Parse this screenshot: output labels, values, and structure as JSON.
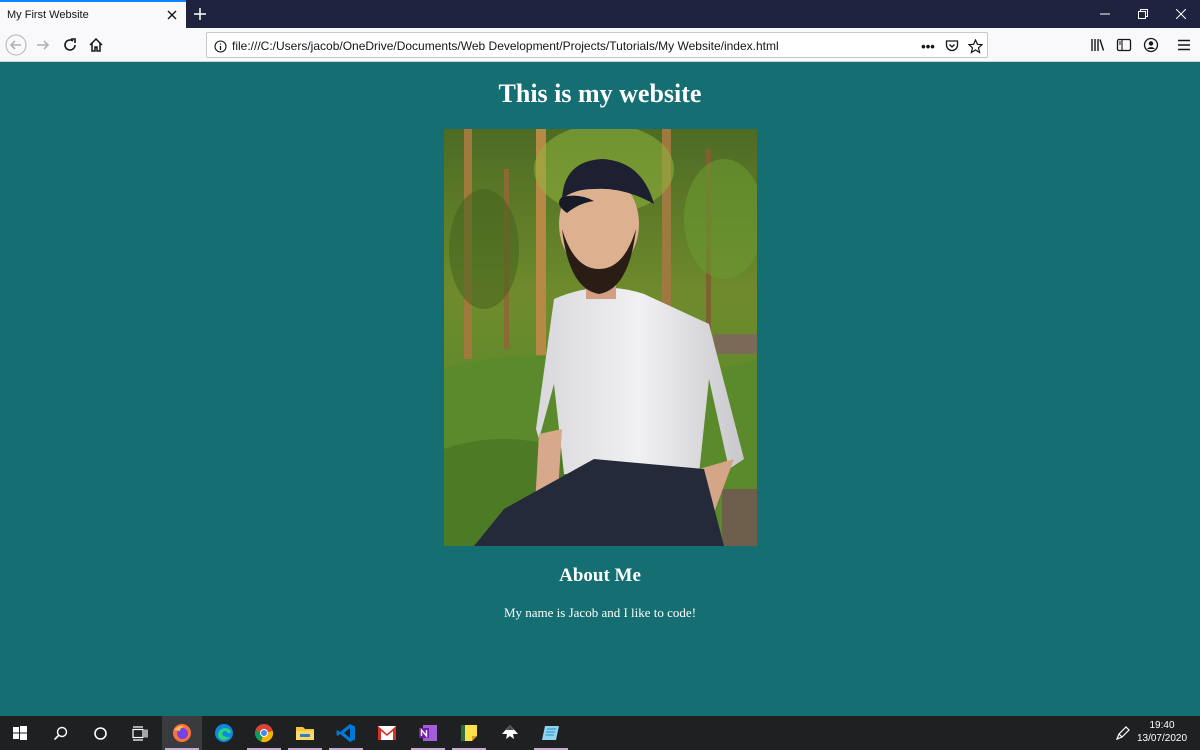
{
  "browser": {
    "tab_title": "My First Website",
    "url": "file:///C:/Users/jacob/OneDrive/Documents/Web Development/Projects/Tutorials/My Website/index.html",
    "page_actions_label": "•••"
  },
  "page": {
    "heading": "This is my website",
    "photo_icon": "profile-photo",
    "about_heading": "About Me",
    "about_text": "My name is Jacob and I like to code!"
  },
  "taskbar": {
    "time": "19:40",
    "date": "13/07/2020",
    "apps": [
      "firefox",
      "edge",
      "chrome",
      "file-explorer",
      "vscode",
      "gmail",
      "onenote",
      "sticky-notes",
      "inkscape",
      "notepad"
    ]
  },
  "colors": {
    "page_background": "#146e72",
    "tab_strip": "#202340",
    "taskbar": "#1f2022",
    "accent": "#0a84ff"
  }
}
